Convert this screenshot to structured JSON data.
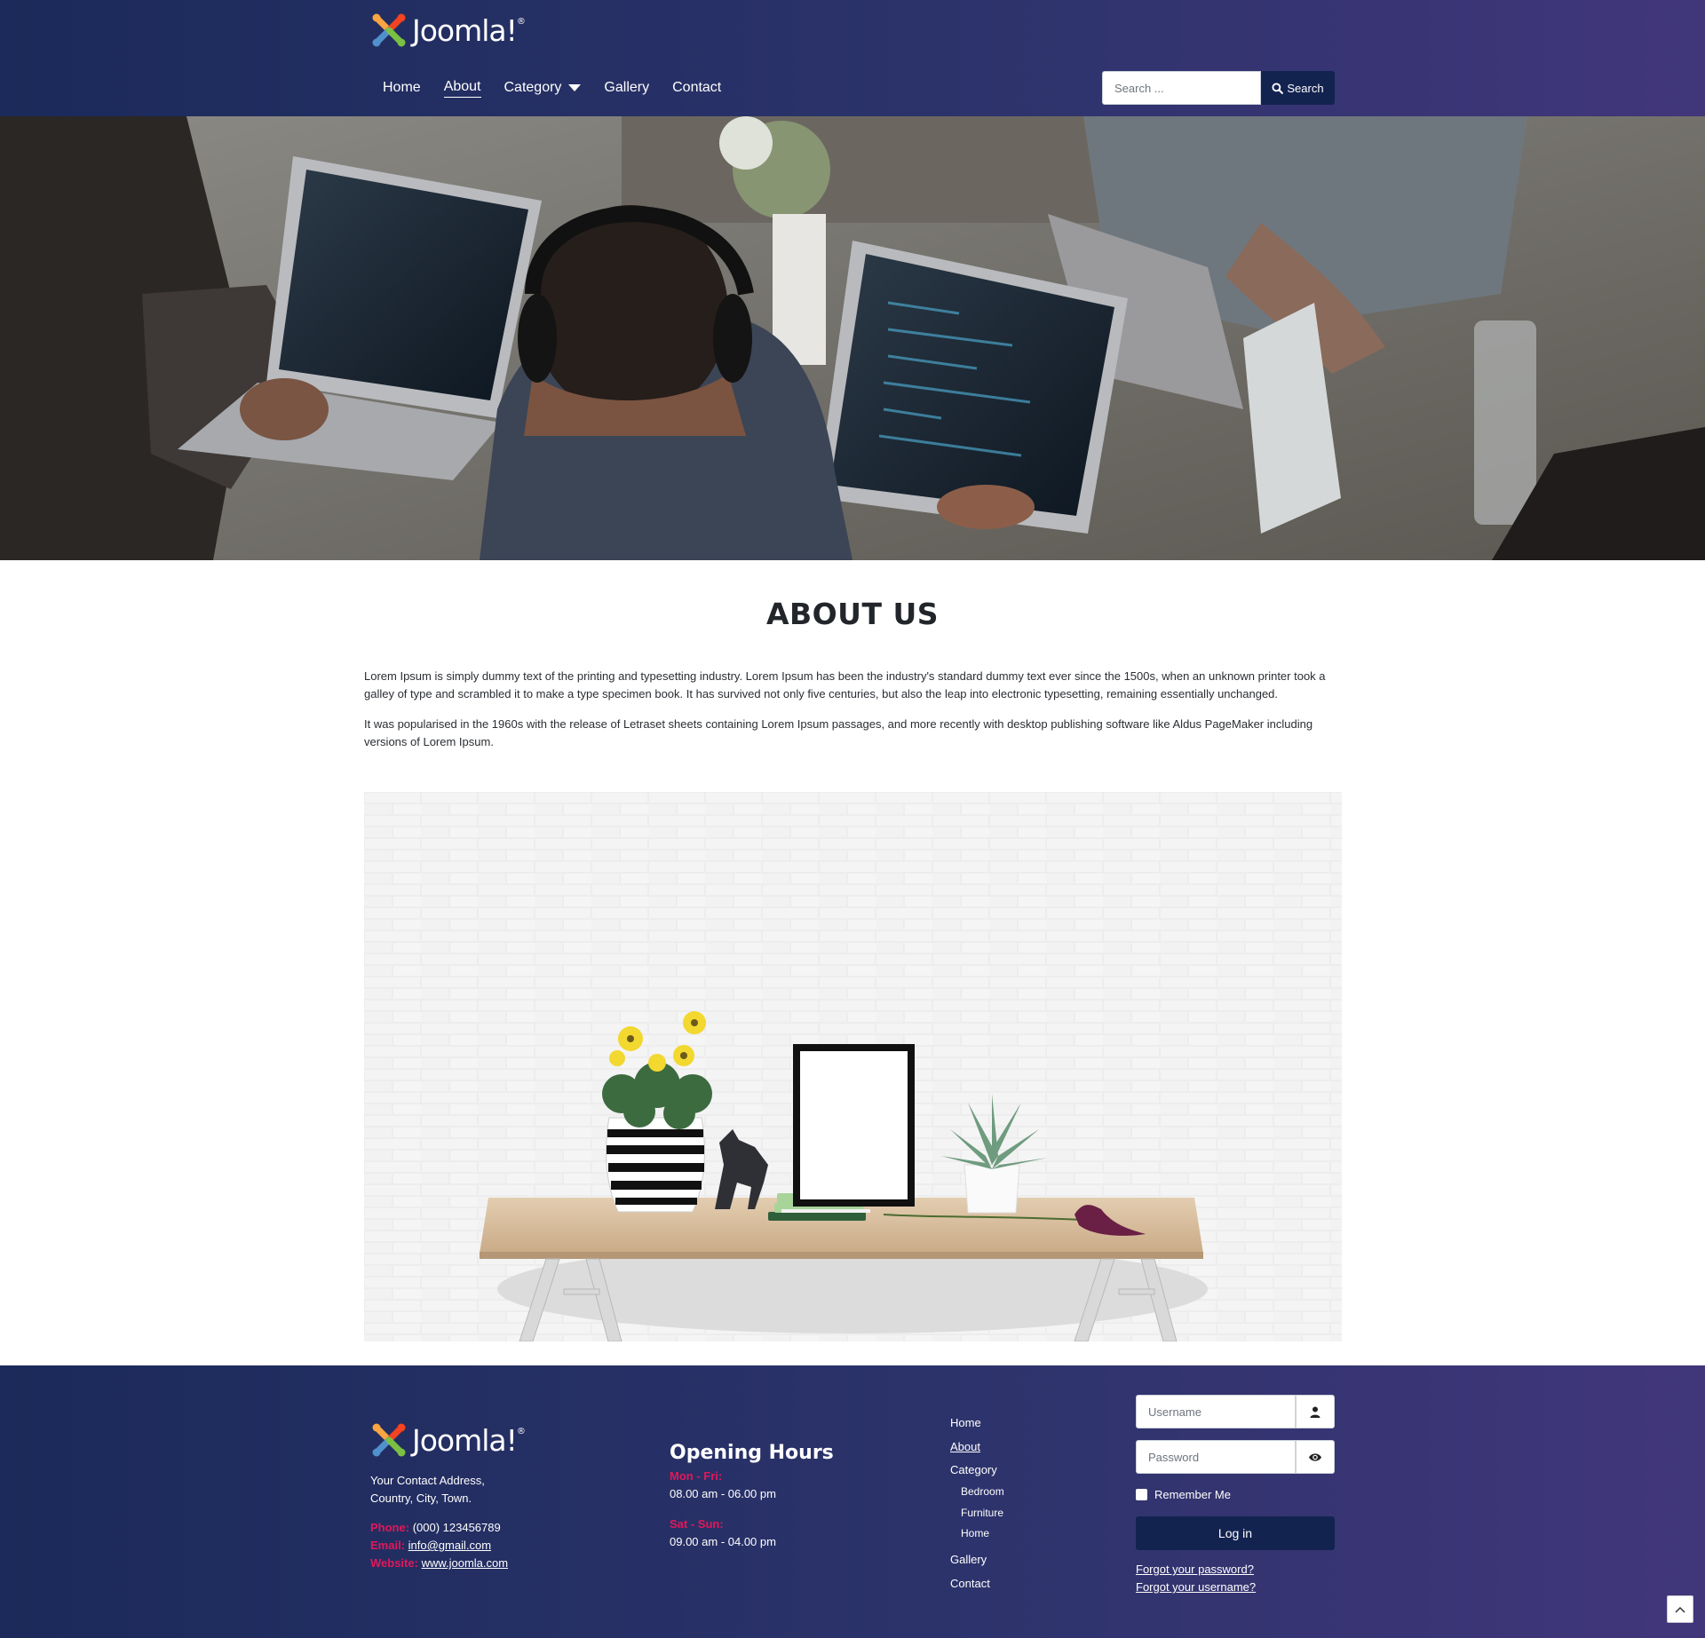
{
  "header": {
    "logo_text": "Joomla!",
    "nav": [
      {
        "label": "Home"
      },
      {
        "label": "About"
      },
      {
        "label": "Category"
      },
      {
        "label": "Gallery"
      },
      {
        "label": "Contact"
      }
    ],
    "search_placeholder": "Search ...",
    "search_button": "Search"
  },
  "hero": {
    "alt": "People working on laptops"
  },
  "main": {
    "title": "ABOUT US",
    "paragraphs": [
      "Lorem Ipsum is simply dummy text of the printing and typesetting industry. Lorem Ipsum has been the industry's standard dummy text ever since the 1500s, when an unknown printer took a galley of type and scrambled it to make a type specimen book. It has survived not only five centuries, but also the leap into electronic typesetting, remaining essentially unchanged.",
      "It was popularised in the 1960s with the release of Letraset sheets containing Lorem Ipsum passages, and more recently with desktop publishing software like Aldus PageMaker including versions of Lorem Ipsum."
    ],
    "image_alt": "Desk with plants and frame"
  },
  "footer": {
    "logo_text": "Joomla!",
    "address_line1": "Your Contact Address,",
    "address_line2": "Country, City, Town.",
    "phone_label": "Phone:",
    "phone": "(000) 123456789",
    "email_label": "Email:",
    "email": "info@gmail.com",
    "website_label": "Website:",
    "website": "www.joomla.com",
    "hours": {
      "title": "Opening Hours",
      "weekday_label": "Mon - Fri:",
      "weekday_time": "08.00 am - 06.00 pm",
      "weekend_label": "Sat - Sun:",
      "weekend_time": "09.00 am - 04.00 pm"
    },
    "menu": {
      "home": "Home",
      "about": "About",
      "category": "Category",
      "sub": [
        "Bedroom",
        "Furniture",
        "Home"
      ],
      "gallery": "Gallery",
      "contact": "Contact"
    },
    "login": {
      "username_placeholder": "Username",
      "password_placeholder": "Password",
      "remember": "Remember Me",
      "button": "Log in",
      "forgot_password": "Forgot your password?",
      "forgot_username": "Forgot your username?"
    }
  },
  "colors": {
    "header_bg_start": "#1b2a5a",
    "header_bg_end": "#41367a",
    "button_bg": "#132350",
    "accent_pink": "#e2175a"
  }
}
